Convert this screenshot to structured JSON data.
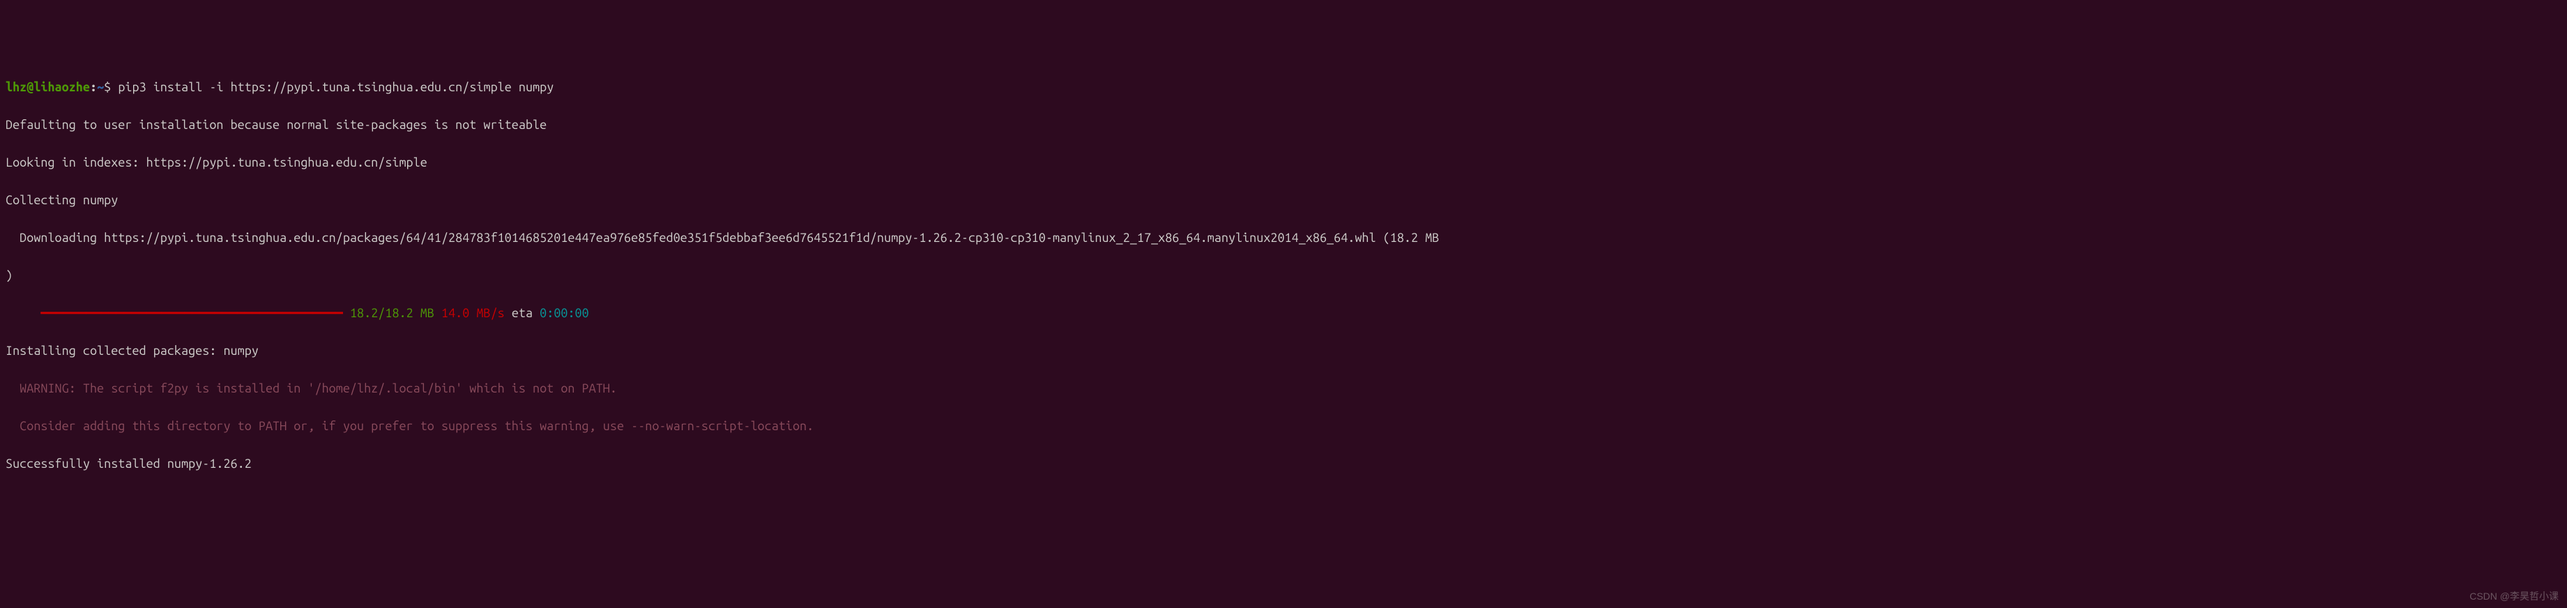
{
  "prompt": {
    "user": "lhz@lihaozhe",
    "colon": ":",
    "path": "~",
    "dollar": "$ ",
    "command": "pip3 install -i https://pypi.tuna.tsinghua.edu.cn/simple numpy"
  },
  "lines": {
    "l1": "Defaulting to user installation because normal site-packages is not writeable",
    "l2": "Looking in indexes: https://pypi.tuna.tsinghua.edu.cn/simple",
    "l3": "Collecting numpy",
    "l4": "  Downloading https://pypi.tuna.tsinghua.edu.cn/packages/64/41/284783f1014685201e447ea976e85fed0e351f5debbaf3ee6d7645521f1d/numpy-1.26.2-cp310-cp310-manylinux_2_17_x86_64.manylinux2014_x86_64.whl (18.2 MB",
    "l4b": ")",
    "progress_indent": "     ",
    "progress_bar": "━━━━━━━━━━━━━━━━━━━━━━━━━━━━━━━━━━━━━━━━",
    "progress_size": " 18.2/18.2 MB",
    "progress_speed": " 14.0 MB/s",
    "progress_eta_label": " eta ",
    "progress_time": "0:00:00",
    "l6": "Installing collected packages: numpy",
    "l7": "  WARNING: The script f2py is installed in '/home/lhz/.local/bin' which is not on PATH.",
    "l8": "  Consider adding this directory to PATH or, if you prefer to suppress this warning, use --no-warn-script-location.",
    "l9": "Successfully installed numpy-1.26.2"
  },
  "watermark": "CSDN @李昊哲小课"
}
